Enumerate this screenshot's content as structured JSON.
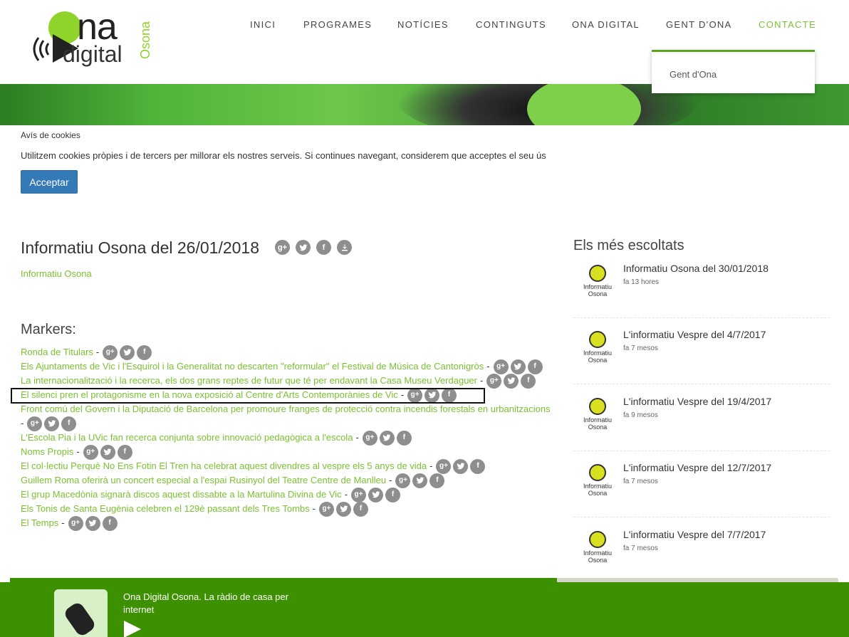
{
  "logo": {
    "na": "na",
    "digital": "digital",
    "osona": "Osona"
  },
  "nav": [
    {
      "label": "INICI",
      "active": false
    },
    {
      "label": "PROGRAMES",
      "active": false
    },
    {
      "label": "NOTÍCIES",
      "active": false
    },
    {
      "label": "CONTINGUTS",
      "active": false
    },
    {
      "label": "ONA DIGITAL",
      "active": false
    },
    {
      "label": "GENT D'ONA",
      "active": false
    },
    {
      "label": "CONTACTE",
      "active": true
    }
  ],
  "dropdown": {
    "item": "Gent d'Ona"
  },
  "cookie": {
    "title": "Avís de cookies",
    "text": "Utilitzem cookies pròpies i de tercers per millorar els nostres serveis. Si continues navegant, considerem que acceptes el seu ús",
    "button": "Acceptar"
  },
  "main": {
    "title": "Informatiu Osona del 26/01/2018",
    "program": "Informatiu Osona",
    "markers_title": "Markers:",
    "markers": [
      "Ronda de Titulars",
      "Els Ajuntaments de Vic i l'Esquirol i la Generalitat no descarten \"reformular\" el Festival de Música de Cantonigròs",
      "La internacionalització i la recerca, els dos grans reptes de futur que té per endavant la Casa Museu Verdaguer",
      "El silenci pren el protagonisme en la nova exposició al Centre d'Arts Contemporànies de Vic",
      "Front comú del Govern i la Diputació de Barcelona per promoure franges de protecció contra incendis forestals en urbanitzacions",
      "L'Escola Pia i la UVic fan recerca conjunta sobre innovació pedagògica a l'escola",
      "Noms Propis",
      "El col·lectiu Perquè No Ens Fotin El Tren ha celebrat aquest divendres al vespre els 5 anys de vida",
      "Guillem Roma oferirà un concert especial a l'espai Rusinyol del Teatre Centre de Manlleu",
      "El grup Macedònia signarà discos aquest dissabte a la Martulina Divina de Vic",
      "Els Tonis de Santa Eugènia celebren el 129è passant dels Tres Tombs",
      "El Temps"
    ],
    "separator": "-"
  },
  "icons": {
    "gplus": "g+",
    "twitter": "twitter-icon",
    "facebook": "f",
    "download": "download-icon"
  },
  "sidebar": {
    "title": "Els més escoltats",
    "thumb_label_1": "Informatiu",
    "thumb_label_2": "Osona",
    "items": [
      {
        "title": "Informatiu Osona del 30/01/2018",
        "time": "fa 13 hores"
      },
      {
        "title": "L'informatiu Vespre del 4/7/2017",
        "time": "fa 7 mesos"
      },
      {
        "title": "L'informatiu Vespre del 19/4/2017",
        "time": "fa 9 mesos"
      },
      {
        "title": "L'informatiu Vespre del 12/7/2017",
        "time": "fa 7 mesos"
      },
      {
        "title": "L'informatiu Vespre del 7/7/2017",
        "time": "fa 7 mesos"
      }
    ]
  },
  "player": {
    "title": "Ona Digital Osona. La ràdio de casa per internet",
    "progress": 0.66
  },
  "colors": {
    "accent": "#7ac231",
    "player": "#3d9100",
    "button": "#337ab7"
  }
}
